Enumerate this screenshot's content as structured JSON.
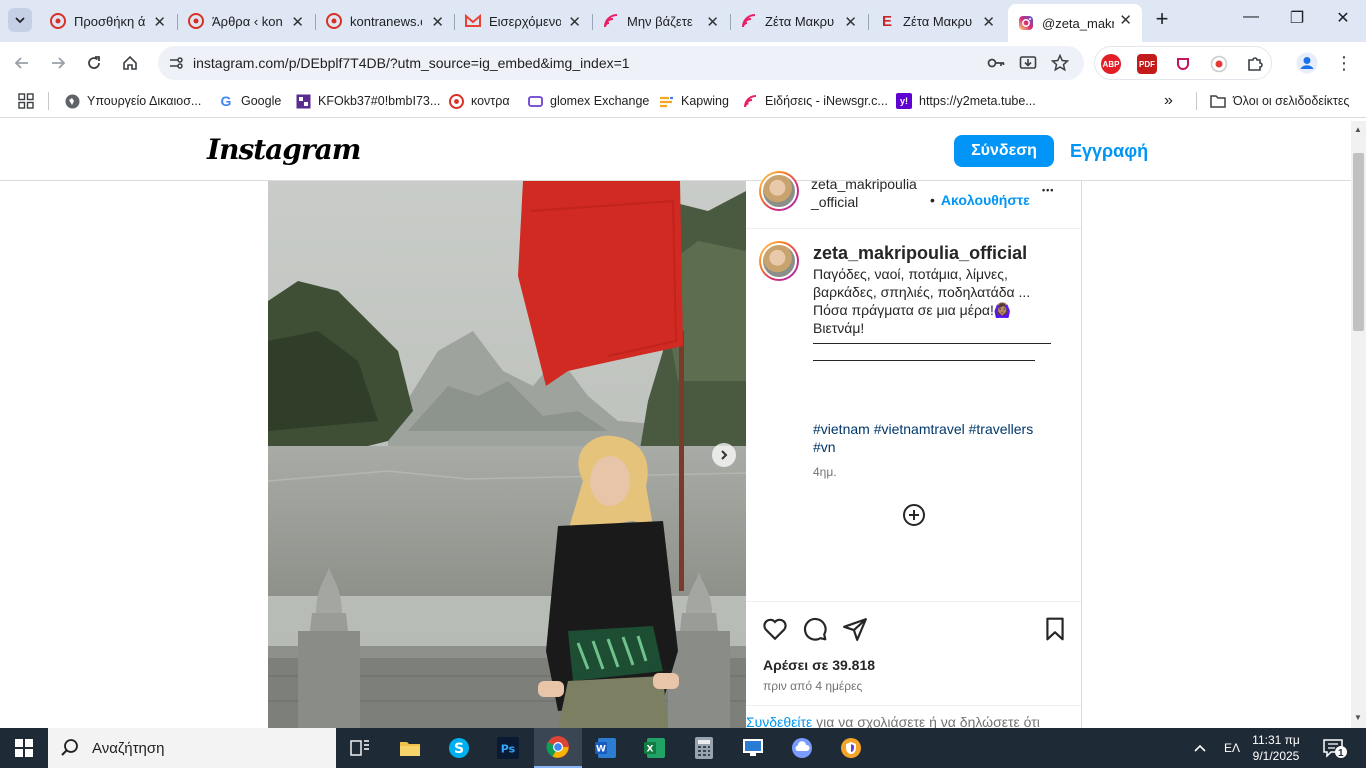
{
  "browser": {
    "tabs": [
      {
        "title": "Προσθήκη ά",
        "icon": "kontra-icon",
        "color": "#d93025"
      },
      {
        "title": "Άρθρα ‹ kon",
        "icon": "kontra-icon",
        "color": "#d93025"
      },
      {
        "title": "kontranews.c",
        "icon": "kontra-icon",
        "color": "#d93025"
      },
      {
        "title": "Εισερχόμενα",
        "icon": "gmail-icon",
        "color": "#ea4335"
      },
      {
        "title": "Μην βάζετε",
        "icon": "inewsgr-icon",
        "color": "#e91e63"
      },
      {
        "title": "Ζέτα Μακρυ",
        "icon": "inewsgr-icon",
        "color": "#e91e63"
      },
      {
        "title": "Ζέτα Μακρυ",
        "icon": "e-icon",
        "color": "#c62828"
      },
      {
        "title": "@zeta_makri",
        "icon": "instagram-icon",
        "color": "#d62976"
      }
    ],
    "url": "instagram.com/p/DEbplf7T4DB/?utm_source=ig_embed&img_index=1",
    "extensions": [
      "ABP",
      "PDF",
      "shield",
      "record",
      "puzzle"
    ],
    "bookmarks": [
      {
        "label": "Υπουργείο Δικαιοσ...",
        "icon": "globe-icon"
      },
      {
        "label": "Google",
        "icon": "google-icon"
      },
      {
        "label": "KFOkb37#0!bmbI73...",
        "icon": "bookmark-app-icon"
      },
      {
        "label": "κοντρα",
        "icon": "kontra-icon"
      },
      {
        "label": "glomex Exchange",
        "icon": "glomex-icon"
      },
      {
        "label": "Kapwing",
        "icon": "kapwing-icon"
      },
      {
        "label": "Ειδήσεις - iNewsgr.c...",
        "icon": "inewsgr-icon"
      },
      {
        "label": "https://y2meta.tube...",
        "icon": "yahoo-icon"
      }
    ],
    "bookmarks_more": "»",
    "all_bookmarks": "Όλοι οι σελιδοδείκτες"
  },
  "instagram": {
    "logo": "Instagram",
    "login": "Σύνδεση",
    "signup": "Εγγραφή",
    "post_user": "zeta_makripoulia_official",
    "post_user_line1": "zeta_makripoulia",
    "post_user_line2": "_official",
    "follow_dot": "•",
    "follow": "Ακολουθήστε",
    "more": "•••",
    "caption_user": "zeta_makripoulia_official",
    "caption_lines": [
      "Παγόδες, ναοί, ποτάμια, λίμνες,",
      "βαρκάδες, σπηλιές, ποδηλατάδα ...",
      "Πόσα πράγματα σε μια μέρα!🙆🏽‍♀️",
      "Βιετνάμ!"
    ],
    "hashtags": "#vietnam #vietnamtravel #travellers #vn",
    "caption_time": "4ημ.",
    "likes": "Αρέσει σε 39.818",
    "ago": "πριν από 4 ημέρες",
    "comment_link": "Συνδεθείτε",
    "comment_rest": " για να σχολιάσετε ή να δηλώσετε ότι"
  },
  "taskbar": {
    "search_placeholder": "Αναζήτηση",
    "language": "ΕΛ",
    "time": "11:31 πμ",
    "date": "9/1/2025",
    "notifications": "1"
  },
  "colors": {
    "ig_blue": "#0095f6",
    "tabstrip": "#dfe7f5",
    "taskbar": "#1f2a37"
  }
}
